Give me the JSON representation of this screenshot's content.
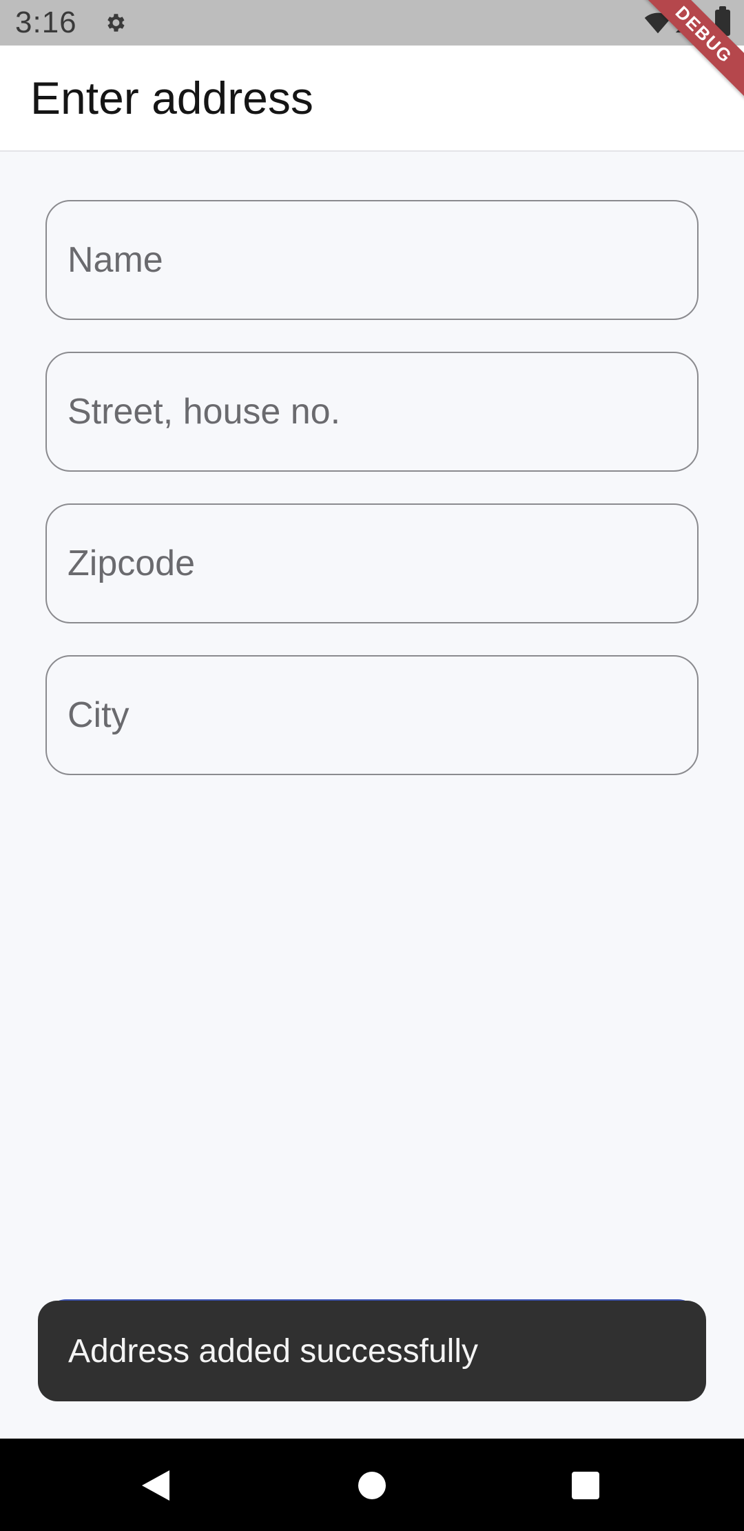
{
  "status_bar": {
    "time": "3:16",
    "icons": [
      "gear-icon",
      "wifi-icon",
      "signal-icon",
      "battery-icon"
    ]
  },
  "debug_banner": {
    "label": "DEBUG",
    "color": "#b5474c"
  },
  "app_bar": {
    "title": "Enter address"
  },
  "form": {
    "name": {
      "placeholder": "Name",
      "value": ""
    },
    "street": {
      "placeholder": "Street, house no.",
      "value": ""
    },
    "zipcode": {
      "placeholder": "Zipcode",
      "value": ""
    },
    "city": {
      "placeholder": "City",
      "value": ""
    }
  },
  "snackbar": {
    "message": "Address added successfully"
  },
  "colors": {
    "background": "#f7f8fb",
    "app_bar": "#ffffff",
    "snackbar": "#303030",
    "accent": "#3e54b3"
  },
  "nav_bar": {
    "icons": [
      "back-icon",
      "home-icon",
      "recents-icon"
    ]
  }
}
